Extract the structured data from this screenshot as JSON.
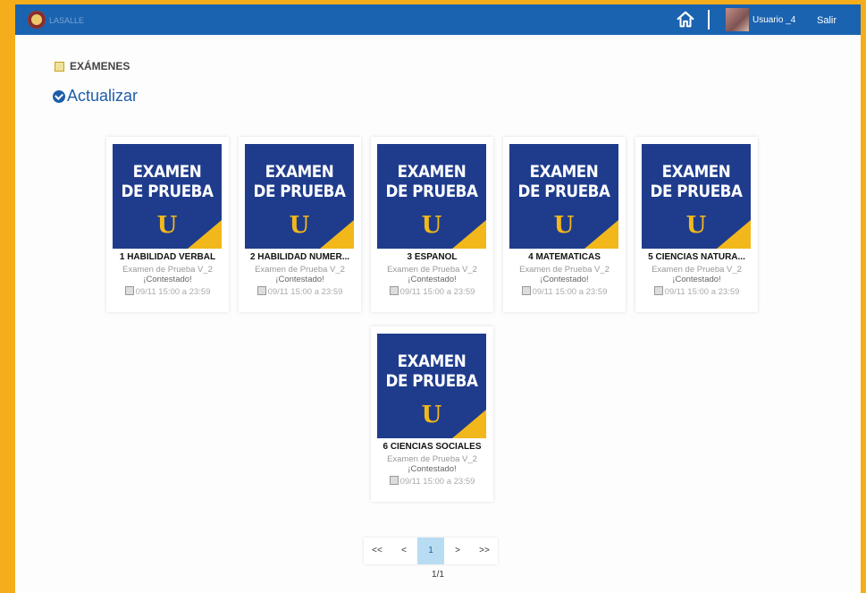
{
  "header": {
    "logo_text": "LASALLE",
    "user_name": "Usuario _4",
    "logout_label": "Salir"
  },
  "section": {
    "title": "EXÁMENES",
    "refresh_label": "Actualizar"
  },
  "cover": {
    "line1": "EXAMEN",
    "line2": "DE PRUEBA",
    "mark": "U"
  },
  "exams": [
    {
      "name": "1 HABILIDAD VERBAL",
      "subtitle": "Examen de Prueba V_2",
      "status": "¡Contestado!",
      "date": "09/11 15:00 a 23:59"
    },
    {
      "name": "2 HABILIDAD NUMER...",
      "subtitle": "Examen de Prueba V_2",
      "status": "¡Contestado!",
      "date": "09/11 15:00 a 23:59"
    },
    {
      "name": "3 ESPANOL",
      "subtitle": "Examen de Prueba V_2",
      "status": "¡Contestado!",
      "date": "09/11 15:00 a 23:59"
    },
    {
      "name": "4 MATEMATICAS",
      "subtitle": "Examen de Prueba V_2",
      "status": "¡Contestado!",
      "date": "09/11 15:00 a 23:59"
    },
    {
      "name": "5 CIENCIAS NATURA...",
      "subtitle": "Examen de Prueba V_2",
      "status": "¡Contestado!",
      "date": "09/11 15:00 a 23:59"
    },
    {
      "name": "6 CIENCIAS SOCIALES",
      "subtitle": "Examen de Prueba V_2",
      "status": "¡Contestado!",
      "date": "09/11 15:00 a 23:59"
    }
  ],
  "pagination": {
    "first": "<<",
    "prev": "<",
    "current": "1",
    "next": ">",
    "last": ">>",
    "info": "1/1"
  },
  "colors": {
    "border": "#f6ad1b",
    "topbar": "#1a63b0",
    "cover_bg": "#1f3c8c",
    "cover_accent": "#f2b81b",
    "active_page": "#b8dcf2"
  }
}
